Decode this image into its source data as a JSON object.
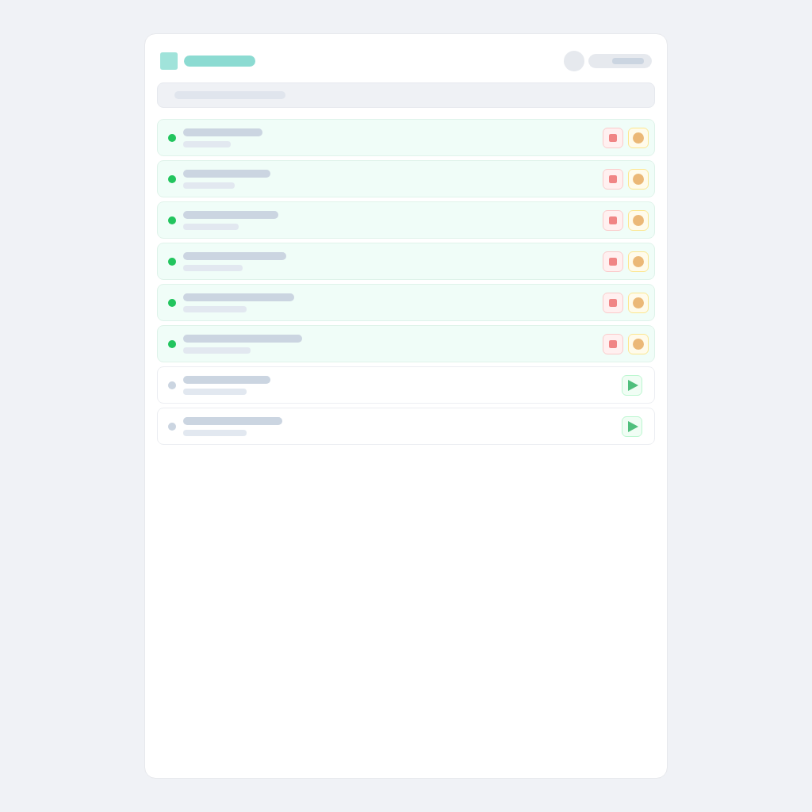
{
  "rows": [
    {
      "running": true
    },
    {
      "running": true
    },
    {
      "running": true
    },
    {
      "running": true
    },
    {
      "running": true
    },
    {
      "running": true
    },
    {
      "running": false
    },
    {
      "running": false
    }
  ]
}
